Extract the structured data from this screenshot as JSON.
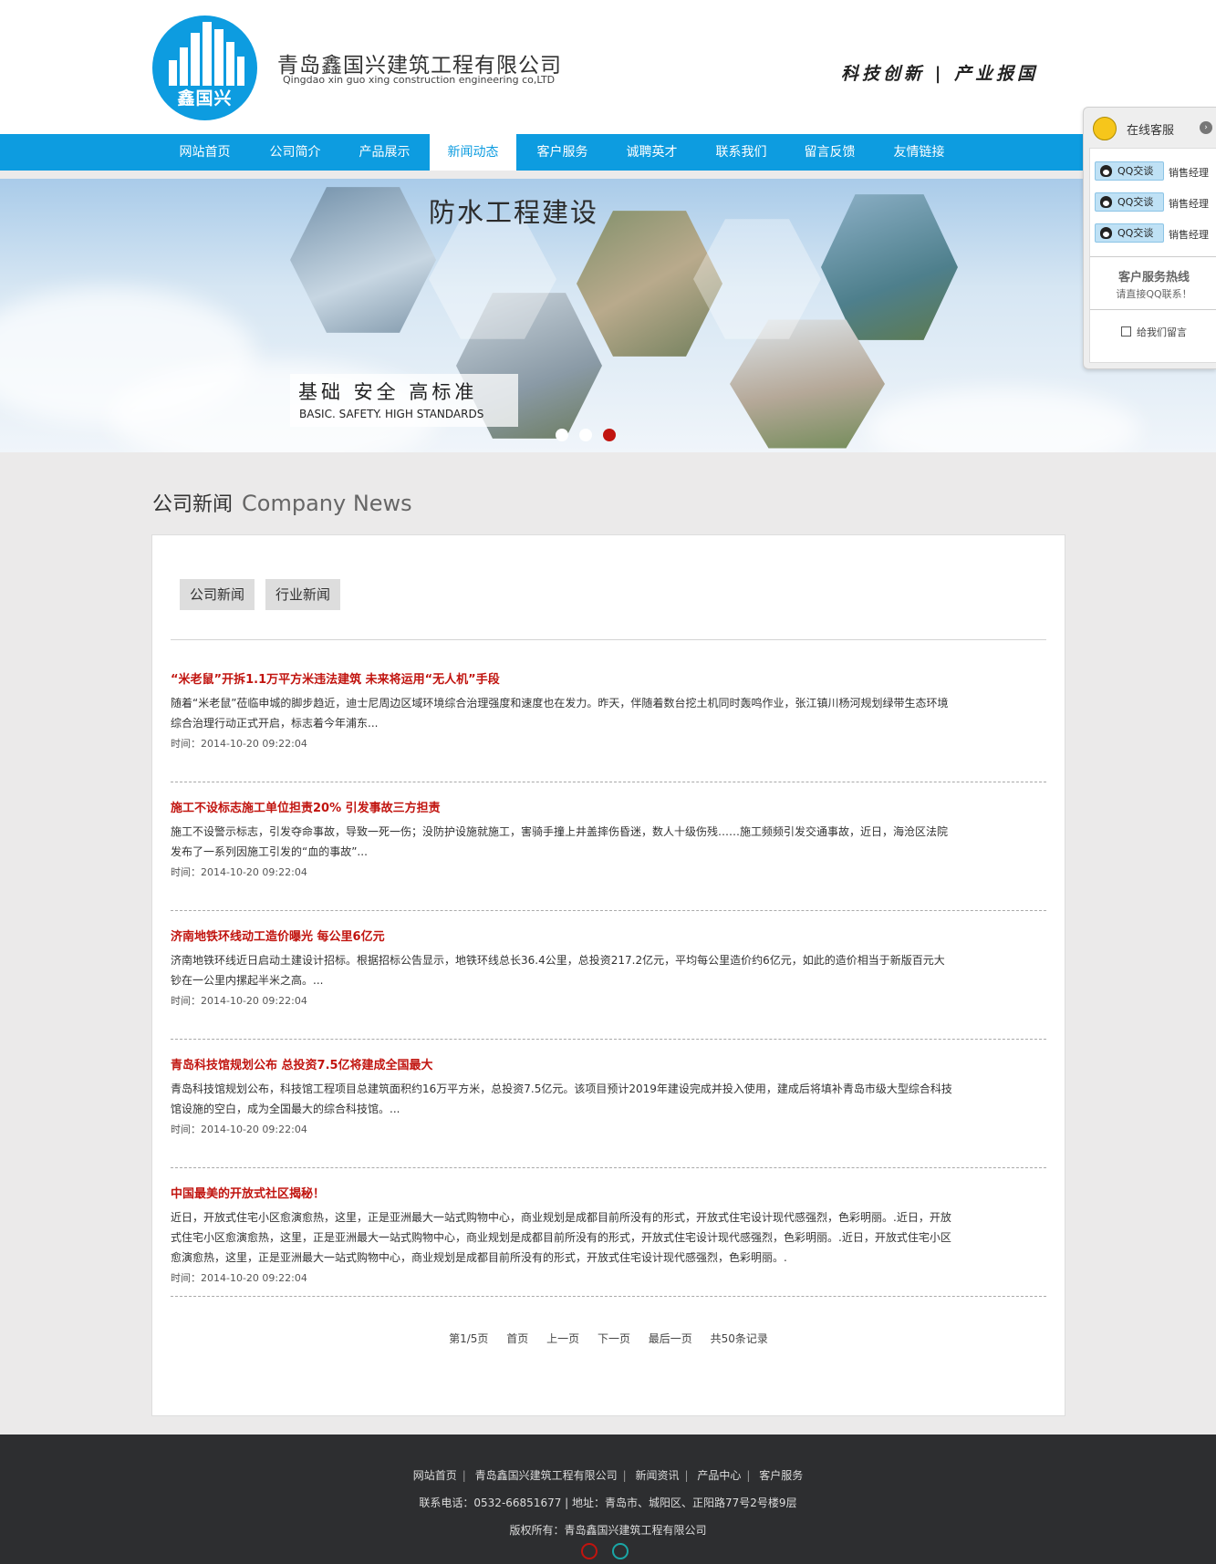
{
  "header": {
    "logo_text": "鑫国兴",
    "company_cn": "青岛鑫国兴建筑工程有限公司",
    "company_en": "Qingdao xin guo xing construction engineering co,LTD",
    "slogan": "科技创新 | 产业报国"
  },
  "nav": {
    "items": [
      "网站首页",
      "公司简介",
      "产品展示",
      "新闻动态",
      "客户服务",
      "诚聘英才",
      "联系我们",
      "留言反馈",
      "友情链接"
    ],
    "active_index": 3
  },
  "banner": {
    "title": "防水工程建设",
    "subtitle_cn": "基础 安全 高标准",
    "subtitle_en": "BASIC. SAFETY. HIGH STANDARDS",
    "slide_count": 3,
    "active_slide": 3
  },
  "section": {
    "title_cn": "公司新闻",
    "title_en": "Company News"
  },
  "tabs": [
    "公司新闻",
    "行业新闻"
  ],
  "news": [
    {
      "title": "“米老鼠”开拆1.1万平方米违法建筑 未来将运用“无人机”手段",
      "summary": "随着“米老鼠”莅临申城的脚步趋近，迪士尼周边区域环境综合治理强度和速度也在发力。昨天，伴随着数台挖土机同时轰鸣作业，张江镇川杨河规划绿带生态环境综合治理行动正式开启，标志着今年浦东...",
      "date": "时间：2014-10-20 09:22:04"
    },
    {
      "title": "施工不设标志施工单位担责20% 引发事故三方担责",
      "summary": "施工不设警示标志，引发夺命事故，导致一死一伤；没防护设施就施工，害骑手撞上井盖摔伤昏迷，数人十级伤残……施工频频引发交通事故，近日，海沧区法院发布了一系列因施工引发的“血的事故”...",
      "date": "时间：2014-10-20 09:22:04"
    },
    {
      "title": "济南地铁环线动工造价曝光 每公里6亿元",
      "summary": "济南地铁环线近日启动土建设计招标。根据招标公告显示，地铁环线总长36.4公里，总投资217.2亿元，平均每公里造价约6亿元，如此的造价相当于新版百元大钞在一公里内摞起半米之高。...",
      "date": "时间：2014-10-20 09:22:04"
    },
    {
      "title": "青岛科技馆规划公布 总投资7.5亿将建成全国最大",
      "summary": "青岛科技馆规划公布，科技馆工程项目总建筑面积约16万平方米，总投资7.5亿元。该项目预计2019年建设完成并投入使用，建成后将填补青岛市级大型综合科技馆设施的空白，成为全国最大的综合科技馆。...",
      "date": "时间：2014-10-20 09:22:04"
    },
    {
      "title": "中国最美的开放式社区揭秘！",
      "summary": "近日，开放式住宅小区愈演愈热，这里，正是亚洲最大一站式购物中心，商业规划是成都目前所没有的形式，开放式住宅设计现代感强烈，色彩明丽。.近日，开放式住宅小区愈演愈热，这里，正是亚洲最大一站式购物中心，商业规划是成都目前所没有的形式，开放式住宅设计现代感强烈，色彩明丽。.近日，开放式住宅小区愈演愈热，这里，正是亚洲最大一站式购物中心，商业规划是成都目前所没有的形式，开放式住宅设计现代感强烈，色彩明丽。.",
      "date": "时间：2014-10-20 09:22:04"
    }
  ],
  "pager": {
    "page_info": "第1/5页",
    "first": "首页",
    "prev": "上一页",
    "next": "下一页",
    "last": "最后一页",
    "total": "共50条记录"
  },
  "footer": {
    "links": [
      "网站首页",
      "青岛鑫国兴建筑工程有限公司",
      "新闻资讯",
      "产品中心",
      "客户服务"
    ],
    "contact": "联系电话：0532-66851677 | 地址：青岛市、城阳区、正阳路77号2号楼9层",
    "copyright": "版权所有：青岛鑫国兴建筑工程有限公司",
    "icons": [
      "weibo-icon",
      "qq-icon"
    ]
  },
  "customer_service": {
    "title": "在线客服",
    "qq_button": "QQ交谈",
    "agents": [
      "销售经理",
      "销售经理",
      "销售经理"
    ],
    "hotline_title": "客户服务热线",
    "hotline_sub": "请直接QQ联系！",
    "leave_message": "给我们留言"
  },
  "colors": {
    "brand_blue": "#0d9ce0",
    "news_red": "#c1140f",
    "footer_bg": "#2d2e30",
    "page_bg": "#ebeaea"
  }
}
